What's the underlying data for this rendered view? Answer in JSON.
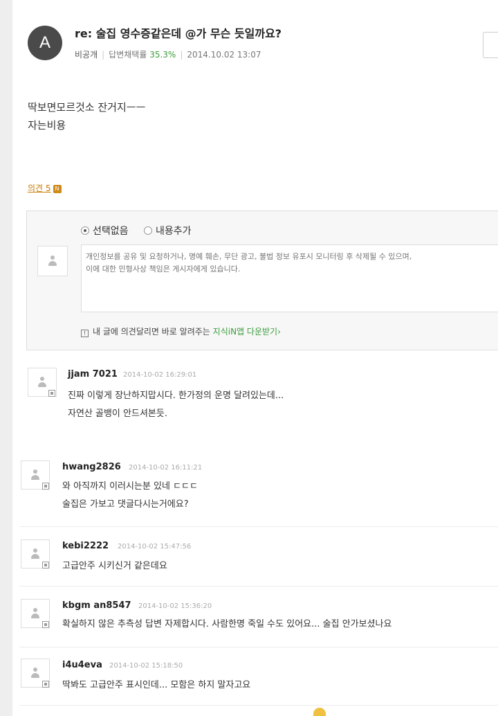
{
  "question": {
    "avatar_letter": "A",
    "title": "re: 술집 영수증같은데 @가 무슨 듯일까요?",
    "visibility": "비공개",
    "adoption_label": "답변채택률",
    "adoption_rate": "35.3%",
    "date": "2014.10.02 13:07",
    "body_lines": [
      "딱보면모르것소 잔거지ㅡㅡ",
      "자는비용"
    ]
  },
  "opinions": {
    "label": "의견 5",
    "badge": "N"
  },
  "write_box": {
    "options": [
      {
        "label": "선택없음",
        "selected": true
      },
      {
        "label": "내용추가",
        "selected": false
      }
    ],
    "placeholder": "개인정보를 공유 및 요청하거나, 명예 훼손, 무단 광고, 불법 정보 유포시 모니터링 후 삭제될 수 있으며,\n이에 대한 민형사상 책임은 게시자에게 있습니다.",
    "promo_prefix": "내 글에 의견달리면 바로 알려주는",
    "promo_app": "지식iN앱 다운받기",
    "promo_arrow": "›"
  },
  "comments": [
    {
      "user": "jjam 7021",
      "time": "2014-10-02 16:29:01",
      "lines": [
        "진짜 이렇게 장난하지맙시다. 한가정의 운명 달려있는데...",
        "자연산 골뱅이 안드셔본듯."
      ]
    },
    {
      "user": "hwang2826",
      "time": "2014-10-02 16:11:21",
      "lines": [
        "와 아직까지 이러시는분 있네 ㄷㄷㄷ",
        "술집은 가보고 댓글다시는거에요?"
      ]
    },
    {
      "user": "kebi2222",
      "time": "2014-10-02 15:47:56",
      "lines": [
        "고급안주 시키신거 같은데요"
      ]
    },
    {
      "user": "kbgm an8547",
      "time": "2014-10-02 15:36:20",
      "lines": [
        "확실하지 않은 추측성 답변 자제합시다. 사람한명 죽일 수도 있어요... 술집 안가보셨나요"
      ]
    },
    {
      "user": "i4u4eva",
      "time": "2014-10-02 15:18:50",
      "lines": [
        "딱봐도 고급안주 표시인데... 모함은 하지 말자고요"
      ]
    }
  ]
}
